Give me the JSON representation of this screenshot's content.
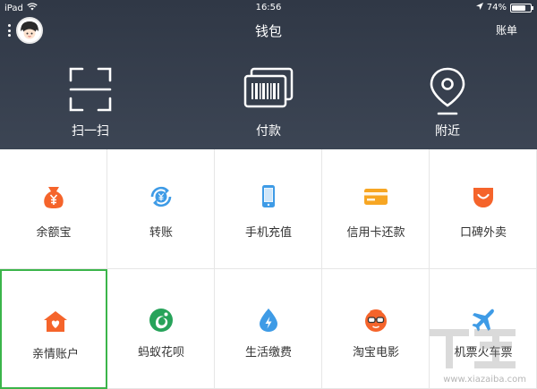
{
  "status_bar": {
    "device": "iPad",
    "time": "16:56",
    "battery": "74%",
    "battery_level": 0.74
  },
  "header": {
    "title": "钱包",
    "bill_label": "账单"
  },
  "quick_actions": [
    {
      "label": "扫一扫",
      "icon": "scan-icon"
    },
    {
      "label": "付款",
      "icon": "barcode-pay-icon"
    },
    {
      "label": "附近",
      "icon": "location-pin-icon"
    }
  ],
  "services": [
    {
      "label": "余额宝",
      "icon": "money-bag-icon",
      "color": "#f5642b"
    },
    {
      "label": "转账",
      "icon": "yuan-transfer-icon",
      "color": "#3e9be6"
    },
    {
      "label": "手机充值",
      "icon": "mobile-phone-icon",
      "color": "#3e9be6"
    },
    {
      "label": "信用卡还款",
      "icon": "credit-card-icon",
      "color": "#f7a623"
    },
    {
      "label": "口碑外卖",
      "icon": "smile-bag-icon",
      "color": "#f5642b"
    },
    {
      "label": "亲情账户",
      "icon": "heart-house-icon",
      "color": "#f5642b"
    },
    {
      "label": "蚂蚁花呗",
      "icon": "huabei-icon",
      "color": "#27a35a"
    },
    {
      "label": "生活缴费",
      "icon": "water-drop-icon",
      "color": "#3e9be6"
    },
    {
      "label": "淘宝电影",
      "icon": "glasses-face-icon",
      "color": "#f5642b"
    },
    {
      "label": "机票火车票",
      "icon": "airplane-icon",
      "color": "#3e9be6"
    }
  ],
  "watermark": {
    "text": "www.xiazaiba.com"
  }
}
